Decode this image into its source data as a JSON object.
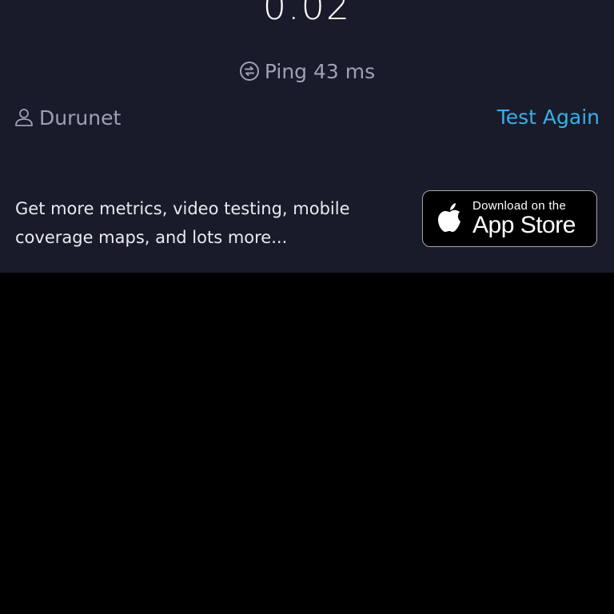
{
  "result": {
    "speed_value": "0.02"
  },
  "ping": {
    "label": "Ping",
    "value": "43",
    "unit": "ms",
    "icon": "ping-icon"
  },
  "provider": {
    "name": "Durunet",
    "icon": "user-icon"
  },
  "actions": {
    "test_again_label": "Test Again"
  },
  "promo": {
    "text": "Get more metrics, video testing, mobile coverage maps, and lots more..."
  },
  "app_store_badge": {
    "small_text": "Download on the",
    "large_text": "App Store",
    "icon": "apple-logo-icon"
  },
  "colors": {
    "panel_background": "#191b2a",
    "accent": "#3aaee8",
    "muted_text": "#9ea1b4",
    "page_background": "#000000"
  }
}
